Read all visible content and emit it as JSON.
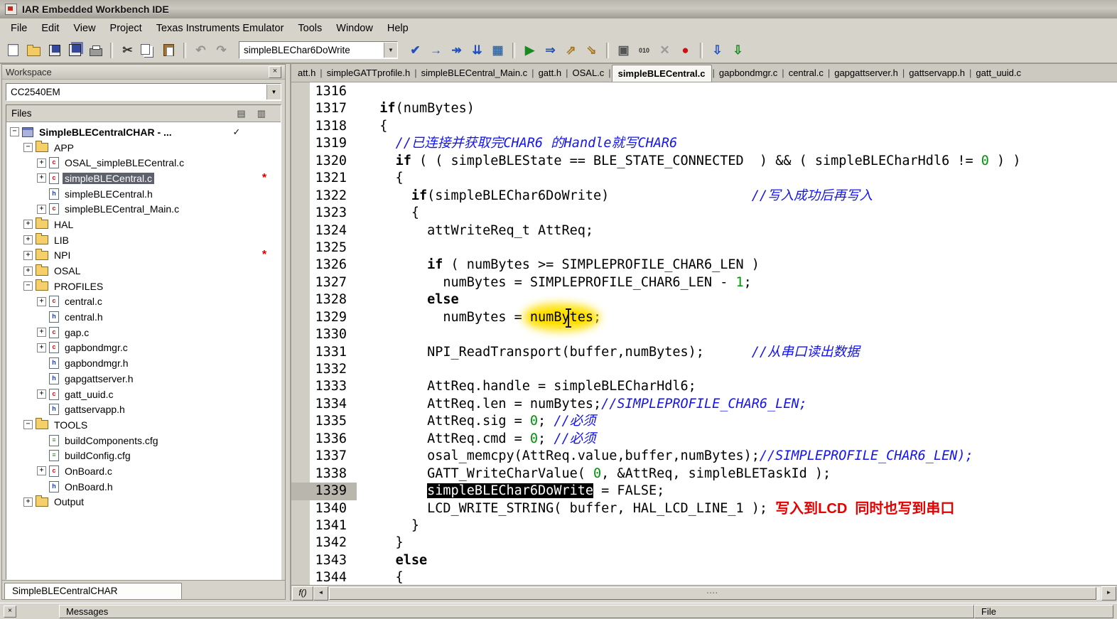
{
  "window": {
    "title": "IAR Embedded Workbench IDE"
  },
  "menubar": {
    "items": [
      "File",
      "Edit",
      "View",
      "Project",
      "Texas Instruments Emulator",
      "Tools",
      "Window",
      "Help"
    ]
  },
  "toolbar": {
    "groups": [
      {
        "buttons": [
          {
            "name": "new-document-button",
            "icon": "page"
          },
          {
            "name": "open-file-button",
            "icon": "folder-open"
          },
          {
            "name": "save-button",
            "icon": "floppy"
          },
          {
            "name": "save-all-button",
            "icon": "floppy-all"
          },
          {
            "name": "print-button",
            "icon": "printer"
          }
        ]
      },
      {
        "buttons": [
          {
            "name": "cut-button",
            "icon": "scissors"
          },
          {
            "name": "copy-button",
            "icon": "copy"
          },
          {
            "name": "paste-button",
            "icon": "paste"
          }
        ]
      },
      {
        "buttons": [
          {
            "name": "undo-button",
            "icon": "undo"
          },
          {
            "name": "redo-button",
            "icon": "redo"
          }
        ]
      }
    ],
    "search_combo": {
      "value": "simpleBLEChar6DoWrite"
    },
    "groups2": [
      {
        "buttons": [
          {
            "name": "find-button",
            "icon": "check-blue"
          },
          {
            "name": "find-next-button",
            "icon": "arrow-next"
          },
          {
            "name": "find-previous-button",
            "icon": "arrow-find"
          },
          {
            "name": "goto-line-button",
            "icon": "goto-line"
          },
          {
            "name": "toggle-bookmark-button",
            "icon": "bookmark-grid"
          }
        ]
      },
      {
        "buttons": [
          {
            "name": "next-statement-button",
            "icon": "play-green"
          },
          {
            "name": "go-button",
            "icon": "go-arrow"
          },
          {
            "name": "open-header-button",
            "icon": "header-up"
          },
          {
            "name": "open-source-button",
            "icon": "source-down"
          }
        ]
      },
      {
        "buttons": [
          {
            "name": "find-in-files-button",
            "icon": "find-files"
          },
          {
            "name": "binary-view-button",
            "icon": "binary"
          },
          {
            "name": "stop-build-button",
            "icon": "stop-x"
          },
          {
            "name": "toggle-breakpoint-button",
            "icon": "debug-bug"
          }
        ]
      },
      {
        "buttons": [
          {
            "name": "download-and-debug-button",
            "icon": "download-debug"
          },
          {
            "name": "debug-without-downloading-button",
            "icon": "download"
          }
        ]
      }
    ]
  },
  "workspace": {
    "title": "Workspace",
    "close_label": "×",
    "target_dropdown": "CC2540EM",
    "files_header": "Files",
    "bottom_tab": "SimpleBLECentralCHAR",
    "tree": [
      {
        "label": "SimpleBLECentralCHAR - ...",
        "depth": 0,
        "type": "workspace",
        "exp": "minus",
        "bold": true,
        "check": "✓"
      },
      {
        "label": "APP",
        "depth": 1,
        "type": "folder",
        "exp": "minus"
      },
      {
        "label": "OSAL_simpleBLECentral.c",
        "depth": 2,
        "type": "cfile",
        "exp": "plus"
      },
      {
        "label": "simpleBLECentral.c",
        "depth": 2,
        "type": "cfile",
        "exp": "plus",
        "selected": true,
        "mark": "*"
      },
      {
        "label": "simpleBLECentral.h",
        "depth": 2,
        "type": "hfile"
      },
      {
        "label": "simpleBLECentral_Main.c",
        "depth": 2,
        "type": "cfile",
        "exp": "plus"
      },
      {
        "label": "HAL",
        "depth": 1,
        "type": "folder",
        "exp": "plus"
      },
      {
        "label": "LIB",
        "depth": 1,
        "type": "folder",
        "exp": "plus"
      },
      {
        "label": "NPI",
        "depth": 1,
        "type": "folder",
        "exp": "plus",
        "mark": "*"
      },
      {
        "label": "OSAL",
        "depth": 1,
        "type": "folder",
        "exp": "plus"
      },
      {
        "label": "PROFILES",
        "depth": 1,
        "type": "folder",
        "exp": "minus"
      },
      {
        "label": "central.c",
        "depth": 2,
        "type": "cfile",
        "exp": "plus"
      },
      {
        "label": "central.h",
        "depth": 2,
        "type": "hfile"
      },
      {
        "label": "gap.c",
        "depth": 2,
        "type": "cfile",
        "exp": "plus"
      },
      {
        "label": "gapbondmgr.c",
        "depth": 2,
        "type": "cfile",
        "exp": "plus"
      },
      {
        "label": "gapbondmgr.h",
        "depth": 2,
        "type": "hfile"
      },
      {
        "label": "gapgattserver.h",
        "depth": 2,
        "type": "hfile"
      },
      {
        "label": "gatt_uuid.c",
        "depth": 2,
        "type": "cfile",
        "exp": "plus"
      },
      {
        "label": "gattservapp.h",
        "depth": 2,
        "type": "hfile"
      },
      {
        "label": "TOOLS",
        "depth": 1,
        "type": "folder",
        "exp": "minus"
      },
      {
        "label": "buildComponents.cfg",
        "depth": 2,
        "type": "cfgfile"
      },
      {
        "label": "buildConfig.cfg",
        "depth": 2,
        "type": "cfgfile"
      },
      {
        "label": "OnBoard.c",
        "depth": 2,
        "type": "cfile",
        "exp": "plus"
      },
      {
        "label": "OnBoard.h",
        "depth": 2,
        "type": "hfile"
      },
      {
        "label": "Output",
        "depth": 1,
        "type": "folder",
        "exp": "plus"
      }
    ]
  },
  "editor": {
    "tabs": [
      {
        "label": "att.h"
      },
      {
        "label": "simpleGATTprofile.h"
      },
      {
        "label": "simpleBLECentral_Main.c"
      },
      {
        "label": "gatt.h"
      },
      {
        "label": "OSAL.c"
      },
      {
        "label": "simpleBLECentral.c",
        "active": true
      },
      {
        "label": "gapbondmgr.c"
      },
      {
        "label": "central.c"
      },
      {
        "label": "gapgattserver.h"
      },
      {
        "label": "gattservapp.h"
      },
      {
        "label": "gatt_uuid.c"
      }
    ],
    "active_line": 1339,
    "hscroll": {
      "fn_label": "f()"
    },
    "code": [
      {
        "n": 1316,
        "seg": []
      },
      {
        "n": 1317,
        "seg": [
          {
            "t": "p",
            "x": "  "
          },
          {
            "t": "k",
            "x": "if"
          },
          {
            "t": "p",
            "x": "(numBytes)"
          }
        ]
      },
      {
        "n": 1318,
        "seg": [
          {
            "t": "p",
            "x": "  {"
          }
        ]
      },
      {
        "n": 1319,
        "seg": [
          {
            "t": "p",
            "x": "    "
          },
          {
            "t": "c",
            "x": "//已连接并获取完CHAR6 的Handle就写CHAR6"
          }
        ]
      },
      {
        "n": 1320,
        "seg": [
          {
            "t": "p",
            "x": "    "
          },
          {
            "t": "k",
            "x": "if"
          },
          {
            "t": "p",
            "x": " ( ( simpleBLEState == BLE_STATE_CONNECTED  ) && ( simpleBLECharHdl6 != "
          },
          {
            "t": "n",
            "x": "0"
          },
          {
            "t": "p",
            "x": " ) )"
          }
        ]
      },
      {
        "n": 1321,
        "seg": [
          {
            "t": "p",
            "x": "    {"
          }
        ]
      },
      {
        "n": 1322,
        "seg": [
          {
            "t": "p",
            "x": "      "
          },
          {
            "t": "k",
            "x": "if"
          },
          {
            "t": "p",
            "x": "(simpleBLEChar6DoWrite)                  "
          },
          {
            "t": "c",
            "x": "//写入成功后再写入"
          }
        ]
      },
      {
        "n": 1323,
        "seg": [
          {
            "t": "p",
            "x": "      {"
          }
        ]
      },
      {
        "n": 1324,
        "seg": [
          {
            "t": "p",
            "x": "        attWriteReq_t AttReq;"
          }
        ]
      },
      {
        "n": 1325,
        "seg": []
      },
      {
        "n": 1326,
        "seg": [
          {
            "t": "p",
            "x": "        "
          },
          {
            "t": "k",
            "x": "if"
          },
          {
            "t": "p",
            "x": " ( numBytes >= SIMPLEPROFILE_CHAR6_LEN )"
          }
        ]
      },
      {
        "n": 1327,
        "seg": [
          {
            "t": "p",
            "x": "          numBytes = SIMPLEPROFILE_CHAR6_LEN - "
          },
          {
            "t": "n",
            "x": "1"
          },
          {
            "t": "p",
            "x": ";"
          }
        ]
      },
      {
        "n": 1328,
        "seg": [
          {
            "t": "p",
            "x": "        "
          },
          {
            "t": "k",
            "x": "else"
          }
        ]
      },
      {
        "n": 1329,
        "seg": [
          {
            "t": "p",
            "x": "          numBytes = "
          },
          {
            "t": "h",
            "x": "numBytes"
          },
          {
            "t": "p",
            "x": ";"
          }
        ]
      },
      {
        "n": 1330,
        "seg": []
      },
      {
        "n": 1331,
        "seg": [
          {
            "t": "p",
            "x": "        NPI_ReadTransport(buffer,numBytes);      "
          },
          {
            "t": "c",
            "x": "//从串口读出数据"
          }
        ]
      },
      {
        "n": 1332,
        "seg": []
      },
      {
        "n": 1333,
        "seg": [
          {
            "t": "p",
            "x": "        AttReq.handle = simpleBLECharHdl6;"
          }
        ]
      },
      {
        "n": 1334,
        "seg": [
          {
            "t": "p",
            "x": "        AttReq.len = numBytes;"
          },
          {
            "t": "c",
            "x": "//SIMPLEPROFILE_CHAR6_LEN;"
          }
        ]
      },
      {
        "n": 1335,
        "seg": [
          {
            "t": "p",
            "x": "        AttReq.sig = "
          },
          {
            "t": "n",
            "x": "0"
          },
          {
            "t": "p",
            "x": "; "
          },
          {
            "t": "c",
            "x": "//必须"
          }
        ]
      },
      {
        "n": 1336,
        "seg": [
          {
            "t": "p",
            "x": "        AttReq.cmd = "
          },
          {
            "t": "n",
            "x": "0"
          },
          {
            "t": "p",
            "x": "; "
          },
          {
            "t": "c",
            "x": "//必须"
          }
        ]
      },
      {
        "n": 1337,
        "seg": [
          {
            "t": "p",
            "x": "        osal_memcpy(AttReq.value,buffer,numBytes);"
          },
          {
            "t": "c",
            "x": "//SIMPLEPROFILE_CHAR6_LEN);"
          }
        ]
      },
      {
        "n": 1338,
        "seg": [
          {
            "t": "p",
            "x": "        GATT_WriteCharValue( "
          },
          {
            "t": "n",
            "x": "0"
          },
          {
            "t": "p",
            "x": ", &AttReq, simpleBLETaskId );"
          }
        ]
      },
      {
        "n": 1339,
        "seg": [
          {
            "t": "p",
            "x": "        "
          },
          {
            "t": "s",
            "x": "simpleBLEChar6DoWrite"
          },
          {
            "t": "p",
            "x": " = FALSE;"
          }
        ]
      },
      {
        "n": 1340,
        "seg": [
          {
            "t": "p",
            "x": "        LCD_WRITE_STRING( buffer, HAL_LCD_LINE_1 ); "
          },
          {
            "t": "a",
            "x": "写入到LCD  同时也写到串口"
          }
        ]
      },
      {
        "n": 1341,
        "seg": [
          {
            "t": "p",
            "x": "      }"
          }
        ]
      },
      {
        "n": 1342,
        "seg": [
          {
            "t": "p",
            "x": "    }"
          }
        ]
      },
      {
        "n": 1343,
        "seg": [
          {
            "t": "p",
            "x": "    "
          },
          {
            "t": "k",
            "x": "else"
          }
        ]
      },
      {
        "n": 1344,
        "seg": [
          {
            "t": "p",
            "x": "    {"
          }
        ]
      }
    ]
  },
  "messages_panel": {
    "close_label": "×",
    "columns": [
      "Messages",
      "File"
    ]
  },
  "colors": {
    "selection_bg": "#5c616b",
    "comment": "#1414f0",
    "number": "#00940a",
    "annotation_red": "#e80000",
    "highlight_yellow": "#ffe000"
  }
}
